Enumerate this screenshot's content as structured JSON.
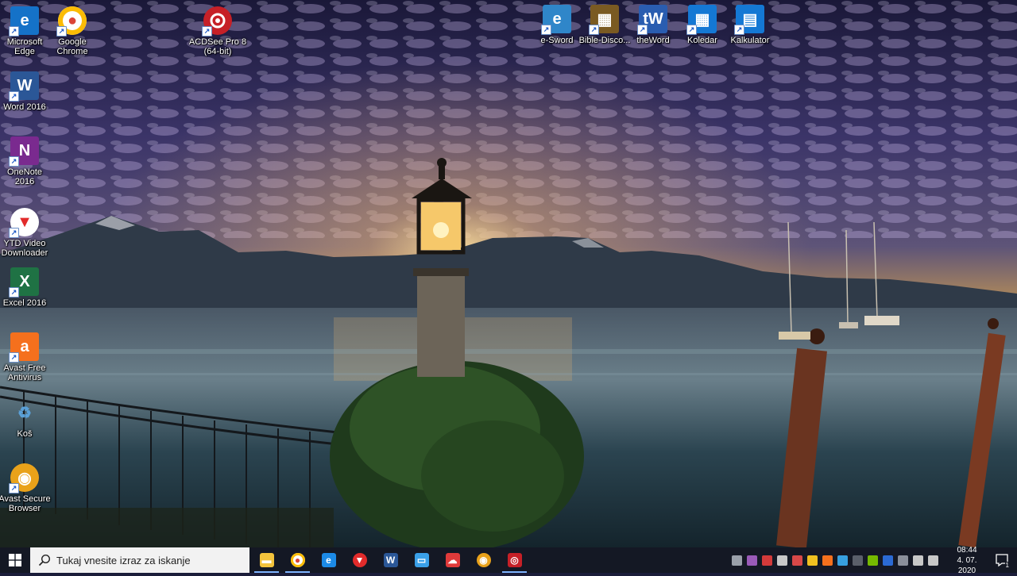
{
  "desktop": {
    "left_icons": [
      {
        "label": "Microsoft\nEdge",
        "icon": "edge-icon",
        "color": "#1572c8"
      },
      {
        "label": "Google\nChrome",
        "icon": "chrome-icon",
        "color": "#ffffff"
      },
      {
        "label": "Word 2016",
        "icon": "word-icon",
        "color": "#2b5797"
      },
      {
        "label": "OneNote\n2016",
        "icon": "onenote-icon",
        "color": "#7a2a8f"
      },
      {
        "label": "YTD Video\nDownloader",
        "icon": "ytd-icon",
        "color": "#e22b2b"
      },
      {
        "label": "Excel 2016",
        "icon": "excel-icon",
        "color": "#1f7244"
      },
      {
        "label": "Avast Free\nAntivirus",
        "icon": "avast-icon",
        "color": "#f5701d"
      },
      {
        "label": "Koš",
        "icon": "recycle-bin-icon",
        "color": "#cfe6f5"
      },
      {
        "label": "Avast Secure\nBrowser",
        "icon": "avast-browser-icon",
        "color": "#e9a21a"
      }
    ],
    "acdsee": {
      "label": "ACDSee Pro 8\n(64-bit)",
      "icon": "acdsee-icon",
      "color": "#c62027"
    },
    "top_icons": [
      {
        "label": "e-Sword",
        "icon": "esword-icon",
        "color": "#2f86c9"
      },
      {
        "label": "Bible-Disco...",
        "icon": "bible-discovery-icon",
        "color": "#7a5a22"
      },
      {
        "label": "theWord",
        "icon": "theword-icon",
        "color": "#2a5db0"
      },
      {
        "label": "Koledar",
        "icon": "calendar-icon",
        "color": "#1478d4"
      },
      {
        "label": "Kalkulator",
        "icon": "calculator-icon",
        "color": "#1478d4"
      }
    ]
  },
  "taskbar": {
    "search_placeholder": "Tukaj vnesite izraz za iskanje",
    "pinned": [
      {
        "name": "file-explorer-icon",
        "color": "#f3c33c",
        "active": true
      },
      {
        "name": "chrome-icon",
        "color": "#ffffff",
        "active": true
      },
      {
        "name": "edge-icon",
        "color": "#1c8ae6",
        "active": false
      },
      {
        "name": "ytd-icon",
        "color": "#e22b2b",
        "active": false
      },
      {
        "name": "word-icon",
        "color": "#2b5797",
        "active": false
      },
      {
        "name": "desktop-app-icon",
        "color": "#3aa0e8",
        "active": false
      },
      {
        "name": "cloud-app-icon",
        "color": "#e03a3a",
        "active": false
      },
      {
        "name": "avast-browser-icon",
        "color": "#e9a21a",
        "active": false
      },
      {
        "name": "acdsee-icon",
        "color": "#c62027",
        "active": true
      }
    ],
    "tray": [
      {
        "name": "pen-off-icon",
        "color": "#9aa0aa"
      },
      {
        "name": "onenote-tray-icon",
        "color": "#9a5ab8"
      },
      {
        "name": "ytd-tray-icon",
        "color": "#d43a3a"
      },
      {
        "name": "phone-icon",
        "color": "#c8c8c8"
      },
      {
        "name": "paint-icon",
        "color": "#d84848"
      },
      {
        "name": "security-shield-icon",
        "color": "#f0c020"
      },
      {
        "name": "avast-tray-icon",
        "color": "#f5701d"
      },
      {
        "name": "app-tray-icon",
        "color": "#37a0e0"
      },
      {
        "name": "keyboard-icon",
        "color": "#5a5f6a"
      },
      {
        "name": "nvidia-icon",
        "color": "#76b900"
      },
      {
        "name": "bluetooth-icon",
        "color": "#2b6ad4"
      },
      {
        "name": "device-icon",
        "color": "#8a8f9a"
      },
      {
        "name": "network-icon",
        "color": "#c8c8c8"
      },
      {
        "name": "volume-icon",
        "color": "#c8c8c8"
      }
    ],
    "clock_time": "08:44",
    "clock_date": "4. 07. 2020",
    "notification_count": "1"
  }
}
